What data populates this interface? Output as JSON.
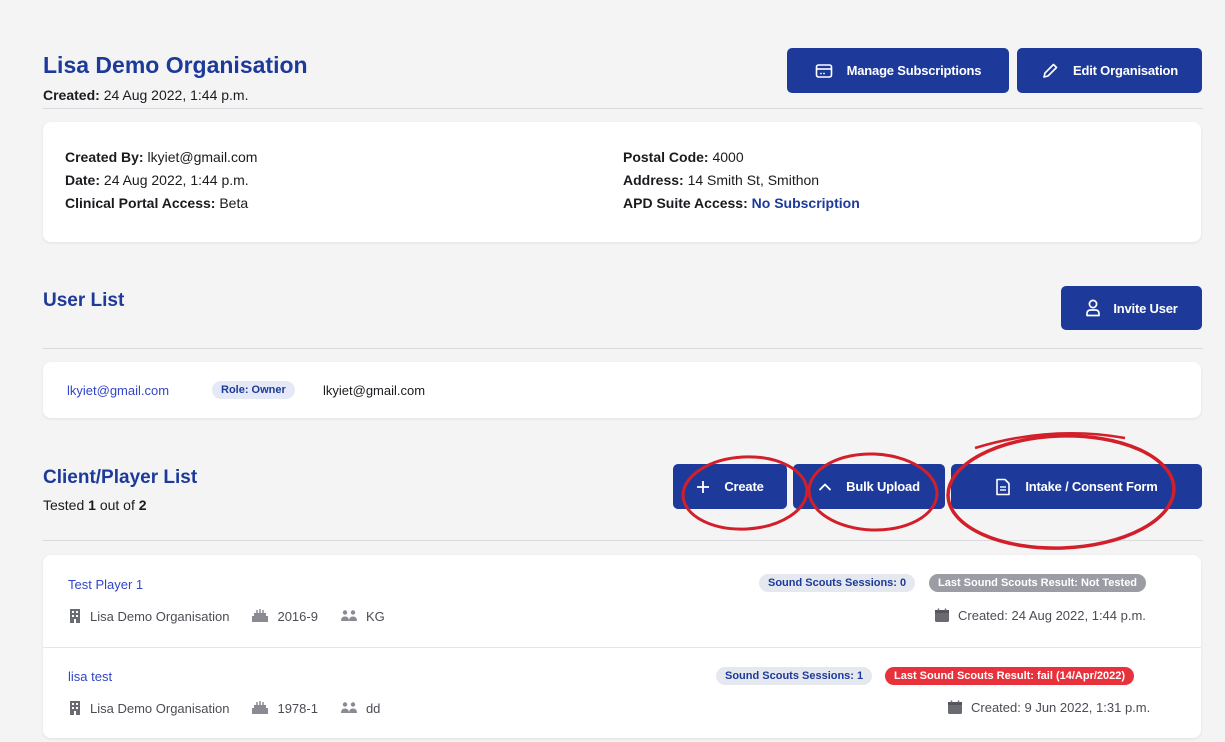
{
  "org": {
    "title": "Lisa Demo Organisation",
    "created_label": "Created:",
    "created_value": "24 Aug 2022, 1:44 p.m."
  },
  "header_buttons": {
    "manage": "Manage Subscriptions",
    "edit": "Edit Organisation"
  },
  "details": {
    "created_by_label": "Created By:",
    "created_by_value": "lkyiet@gmail.com",
    "date_label": "Date:",
    "date_value": "24 Aug 2022, 1:44 p.m.",
    "portal_label": "Clinical Portal Access:",
    "portal_value": "Beta",
    "postal_label": "Postal Code:",
    "postal_value": "4000",
    "address_label": "Address:",
    "address_value": "14 Smith St, Smithon",
    "apd_label": "APD Suite Access:",
    "apd_value": "No Subscription"
  },
  "users": {
    "title": "User List",
    "invite": "Invite User",
    "rows": [
      {
        "email_link": "lkyiet@gmail.com",
        "role": "Role: Owner",
        "name": "lkyiet@gmail.com"
      }
    ]
  },
  "clients": {
    "title": "Client/Player List",
    "tested_prefix": "Tested",
    "tested_count": "1",
    "tested_mid": "out of",
    "tested_total": "2",
    "create": "Create",
    "bulk": "Bulk Upload",
    "intake": "Intake / Consent Form",
    "rows": [
      {
        "name": "Test Player 1",
        "org": "Lisa Demo Organisation",
        "year": "2016-9",
        "group": "KG",
        "sessions": "Sound Scouts Sessions: 0",
        "result": "Last Sound Scouts Result: Not Tested",
        "created": "Created: 24 Aug 2022, 1:44 p.m."
      },
      {
        "name": "lisa test",
        "org": "Lisa Demo Organisation",
        "year": "1978-1",
        "group": "dd",
        "sessions": "Sound Scouts Sessions: 1",
        "result": "Last Sound Scouts Result: fail (14/Apr/2022)",
        "created": "Created: 9 Jun 2022, 1:31 p.m."
      }
    ]
  },
  "colors": {
    "primary": "#1d3a9a",
    "link": "#3246c8",
    "fail": "#e8323b",
    "annotation": "#d21f2a"
  }
}
